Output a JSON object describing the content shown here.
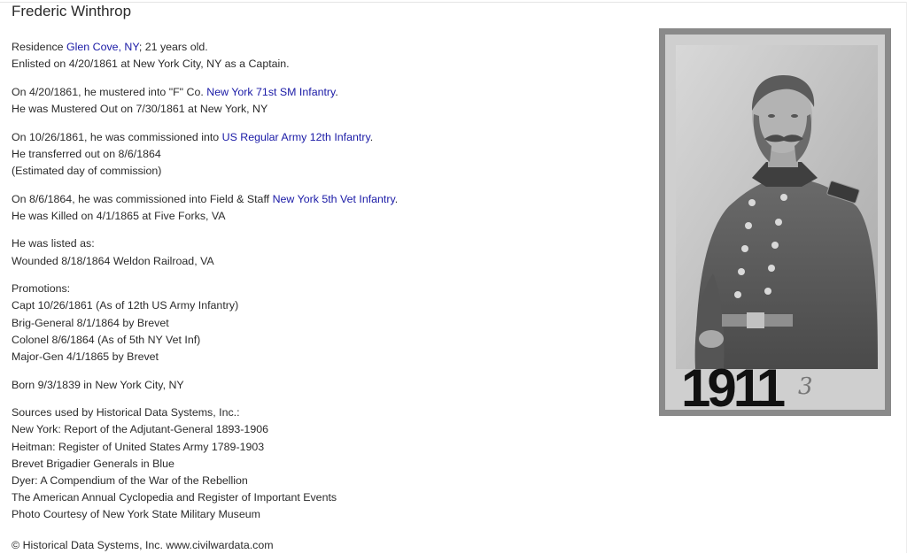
{
  "page_title": "Frederic Winthrop",
  "residence": {
    "prefix": "Residence ",
    "link": "Glen Cove, NY",
    "suffix": "; 21 years old."
  },
  "enlisted": "Enlisted on 4/20/1861 at New York City, NY as a Captain.",
  "service1": {
    "prefix": "On 4/20/1861, he mustered into \"F\" Co. ",
    "link": "New York 71st SM Infantry",
    "suffix": ".",
    "line2": "He was Mustered Out on 7/30/1861 at New York, NY"
  },
  "service2": {
    "prefix": "On 10/26/1861, he was commissioned into ",
    "link": "US Regular Army 12th Infantry",
    "suffix": ".",
    "line2": "He transferred out on 8/6/1864",
    "line3": "(Estimated day of commission)"
  },
  "service3": {
    "prefix": "On 8/6/1864, he was commissioned into Field & Staff ",
    "link": "New York 5th Vet Infantry",
    "suffix": ".",
    "line2": "He was Killed on 4/1/1865 at Five Forks, VA"
  },
  "listed": {
    "heading": "He was listed as:",
    "items": [
      "Wounded 8/18/1864 Weldon Railroad, VA"
    ]
  },
  "promotions": {
    "heading": "Promotions:",
    "items": [
      "Capt 10/26/1861 (As of 12th US Army Infantry)",
      "Brig-General 8/1/1864 by Brevet",
      "Colonel 8/6/1864 (As of 5th NY Vet Inf)",
      "Major-Gen 4/1/1865 by Brevet"
    ]
  },
  "born": "Born 9/3/1839 in New York City, NY",
  "sources": {
    "heading": "Sources used by Historical Data Systems, Inc.:",
    "items": [
      "New York: Report of the Adjutant-General 1893-1906",
      "Heitman: Register of United States Army 1789-1903",
      "Brevet Brigadier Generals in Blue",
      "Dyer: A Compendium of the War of the Rebellion",
      "The American Annual Cyclopedia and Register of Important Events",
      "Photo Courtesy of New York State Military Museum"
    ]
  },
  "footer": "© Historical Data Systems, Inc. www.civilwardata.com",
  "photo": {
    "number_label": "1911",
    "handwritten_mark": "3"
  }
}
